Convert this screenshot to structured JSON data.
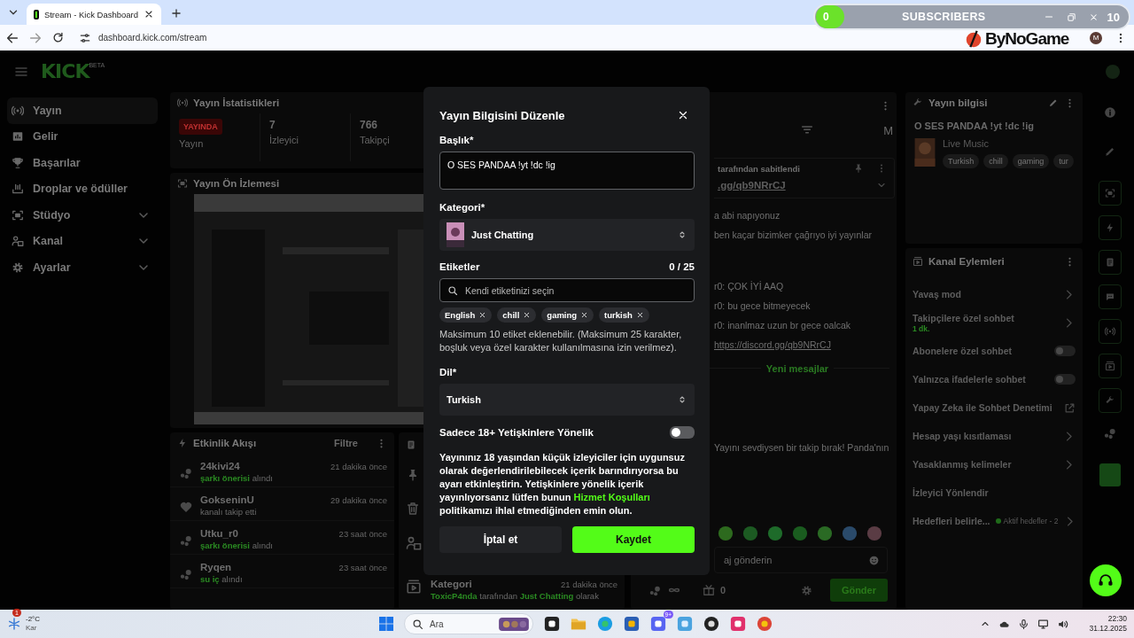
{
  "browser": {
    "tab_title": "Stream - Kick Dashboard",
    "url": "dashboard.kick.com/stream",
    "profile_initial": "M"
  },
  "stream_overlay": {
    "current": "0",
    "label": "SUBSCRIBERS",
    "goal": "10",
    "logo": "ByNoGame"
  },
  "header": {
    "logo": "KICK",
    "logo_badge": "BETA"
  },
  "sidebar": {
    "items": [
      {
        "label": "Yayın",
        "kind": "link",
        "selected": true
      },
      {
        "label": "Gelir",
        "kind": "link",
        "selected": false
      },
      {
        "label": "Başarılar",
        "kind": "link",
        "selected": false
      },
      {
        "label": "Droplar ve ödüller",
        "kind": "link",
        "selected": false
      },
      {
        "label": "Stüdyo",
        "kind": "group",
        "expanded": false,
        "selected": false
      },
      {
        "label": "Kanal",
        "kind": "group",
        "expanded": false,
        "selected": false
      },
      {
        "label": "Ayarlar",
        "kind": "group",
        "expanded": false,
        "selected": false
      }
    ]
  },
  "stats": {
    "title": "Yayın İstatistikleri",
    "tiles": [
      {
        "badge": "YAYINDA",
        "label": "Yayın"
      },
      {
        "value": "7",
        "label": "İzleyici"
      },
      {
        "value": "766",
        "label": "Takipçi"
      }
    ]
  },
  "preview": {
    "title": "Yayın Ön İzlemesi",
    "kind": "picture"
  },
  "activity": {
    "title": "Etkinlik Akışı",
    "filter": "Filtre",
    "events": [
      {
        "kind": "reward",
        "user": "24kivi24",
        "time": "21 dakika önce",
        "highlight": "şarkı önerisi",
        "action": "alındı"
      },
      {
        "kind": "follow",
        "user": "GokseninU",
        "time": "29 dakika önce",
        "action": "kanalı takip etti"
      },
      {
        "kind": "reward",
        "user": "Utku_r0",
        "time": "23 saat önce",
        "highlight": "şarkı önerisi",
        "action": "alındı"
      },
      {
        "kind": "reward",
        "user": "Ryqen",
        "time": "23 saat önce",
        "highlight": "su iç",
        "action": "alındı"
      }
    ]
  },
  "mod_log": {
    "entry": {
      "title": "Kategori",
      "time": "21 dakika önce",
      "user": "ToxicP4nda",
      "middle": "tarafından",
      "category": "Just Chatting",
      "end": "olarak"
    }
  },
  "chat": {
    "header_initial": "M",
    "pinned": {
      "by": "tarafından sabitlendi",
      "link": ".gg/qb9NRrCJ"
    },
    "messages": [
      {
        "kind": "text",
        "text": "a abi napıyonuz"
      },
      {
        "kind": "text",
        "text": "ben kaçar bizimker çağrıyo iyi yayınlar"
      },
      {
        "kind": "text",
        "text": "r0: ÇOK İYİ AAQ"
      },
      {
        "kind": "text",
        "text": "r0: bu gece bitmeyecek"
      },
      {
        "kind": "text",
        "text": "r0: inanlmaz uzun br gece oalcak"
      },
      {
        "kind": "link",
        "text": "https://discord.gg/qb9NRrCJ"
      },
      {
        "kind": "divider",
        "text": "Yeni mesajlar"
      },
      {
        "kind": "text",
        "text": "Yayını sevdiysen bir takip bırak! Panda'nın"
      }
    ],
    "input_placeholder": "aj gönderin",
    "points": "0",
    "send": "Gönder"
  },
  "stream_info": {
    "title": "Yayın bilgisi",
    "stream_title": "O SES PANDAA !yt !dc !ig",
    "category": "Live Music",
    "tags": [
      "Turkish",
      "chill",
      "gaming",
      "tur"
    ]
  },
  "channel_actions": {
    "title": "Kanal Eylemleri",
    "items": [
      {
        "kind": "link",
        "label": "Yavaş mod"
      },
      {
        "kind": "link",
        "label": "Takipçilere özel sohbet",
        "sub": "1 dk."
      },
      {
        "kind": "toggle",
        "label": "Abonelere özel sohbet",
        "on": false
      },
      {
        "kind": "toggle",
        "label": "Yalnızca ifadelerle sohbet",
        "on": false
      },
      {
        "kind": "external",
        "label": "Yapay Zeka ile Sohbet Denetimi"
      },
      {
        "kind": "link",
        "label": "Hesap yaşı kısıtlaması"
      },
      {
        "kind": "link",
        "label": "Yasaklanmış kelimeler"
      },
      {
        "kind": "plain",
        "label": "İzleyici Yönlendir"
      },
      {
        "kind": "link",
        "label": "Hedefleri belirle...",
        "status": "Aktif hedefler - 2"
      }
    ]
  },
  "modal": {
    "title": "Yayın Bilgisini Düzenle",
    "title_label": "Başlık*",
    "title_value": "O SES PANDAA !yt !dc !ig",
    "category_label": "Kategori*",
    "category": "Just Chatting",
    "tags_label": "Etiketler",
    "tags_count": "0 / 25",
    "tags_placeholder": "Kendi etiketinizi seçin",
    "tags": [
      "English",
      "chill",
      "gaming",
      "turkish"
    ],
    "tags_hint": "Maksimum 10 etiket eklenebilir. (Maksimum 25 karakter, boşluk veya özel karakter kullanılmasına izin verilmez).",
    "language_label": "Dil*",
    "language": "Turkish",
    "mature_label": "Sadece 18+ Yetişkinlere Yönelik",
    "mature_on": false,
    "notice_before": "Yayınınız 18 yaşından küçük izleyiciler için uygunsuz olarak değerlendirilebilecek içerik barındırıyorsa bu ayarı etkinleştirin. Yetişkinlere yönelik içerik yayınlıyorsanız lütfen bunun ",
    "notice_link": "Hizmet Koşulları",
    "notice_after": " politikamızı ihlal etmediğinden emin olun.",
    "buttons": [
      {
        "kind": "secondary",
        "label": "İptal et"
      },
      {
        "kind": "primary",
        "label": "Kaydet"
      }
    ]
  },
  "taskbar": {
    "weather_badge": "1",
    "temperature": "-2°C",
    "weather": "Kar",
    "search_placeholder": "Ara",
    "apps": [
      {
        "kind": "files"
      },
      {
        "kind": "folder"
      },
      {
        "kind": "edge"
      },
      {
        "kind": "store"
      },
      {
        "kind": "discord",
        "badge": "9+"
      },
      {
        "kind": "gear"
      },
      {
        "kind": "obs"
      },
      {
        "kind": "tiktok"
      },
      {
        "kind": "chrome"
      }
    ],
    "time": "22:30",
    "date": "31.12.2025"
  }
}
